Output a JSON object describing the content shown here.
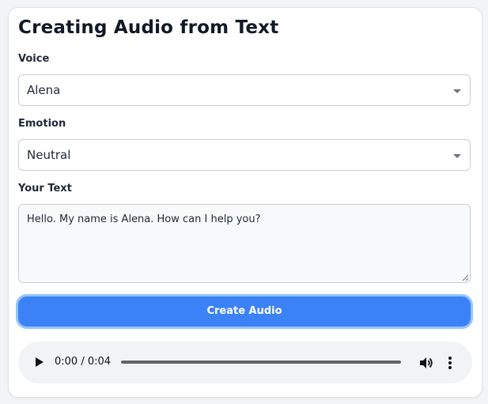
{
  "form": {
    "title": "Creating Audio from Text",
    "voice": {
      "label": "Voice",
      "selected": "Alena"
    },
    "emotion": {
      "label": "Emotion",
      "selected": "Neutral"
    },
    "text": {
      "label": "Your Text",
      "value": "Hello. My name is Alena. How can I help you?"
    },
    "submit_label": "Create Audio"
  },
  "player": {
    "current_time": "0:00",
    "duration": "0:04",
    "time_display": "0:00 / 0:04",
    "progress": 0,
    "icons": {
      "play": "play-icon",
      "volume": "volume-icon",
      "more": "more-options-icon"
    }
  },
  "colors": {
    "accent": "#3b82f6",
    "accent_ring": "#93c5fd",
    "card_bg": "#ffffff",
    "page_bg": "#f3f4f6"
  }
}
